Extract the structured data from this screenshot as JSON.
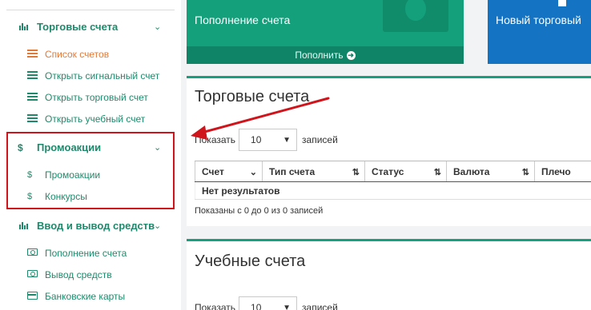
{
  "sidebar": {
    "trading": {
      "title": "Торговые счета",
      "items": [
        {
          "label": "Список счетов",
          "active": true
        },
        {
          "label": "Открыть сигнальный счет"
        },
        {
          "label": "Открыть торговый счет"
        },
        {
          "label": "Открыть учебный счет"
        }
      ]
    },
    "promo": {
      "title": "Промоакции",
      "items": [
        {
          "label": "Промоакции"
        },
        {
          "label": "Конкурсы"
        }
      ]
    },
    "funds": {
      "title": "Ввод и вывод средств",
      "items": [
        {
          "label": "Пополнение счета"
        },
        {
          "label": "Вывод средств"
        },
        {
          "label": "Банковские карты"
        }
      ]
    }
  },
  "tiles": {
    "deposit": {
      "title": "Пополнение счета",
      "action": "Пополнить"
    },
    "new_account": {
      "title": "Новый торговый"
    }
  },
  "panels": {
    "trading": {
      "title": "Торговые счета",
      "show_label": "Показать",
      "page_size": "10",
      "records_label": "записей",
      "columns": [
        "Счет",
        "Тип счета",
        "Статус",
        "Валюта",
        "Плечо"
      ],
      "empty": "Нет результатов",
      "info": "Показаны с 0 до 0 из 0 записей"
    },
    "demo": {
      "title": "Учебные счета",
      "show_label": "Показать",
      "page_size": "10",
      "records_label": "записей"
    }
  },
  "colors": {
    "accent": "#1f8a6b",
    "active": "#e07a3b",
    "tile_green": "#15a07c",
    "tile_blue": "#1573c3",
    "highlight": "#d0141c"
  }
}
